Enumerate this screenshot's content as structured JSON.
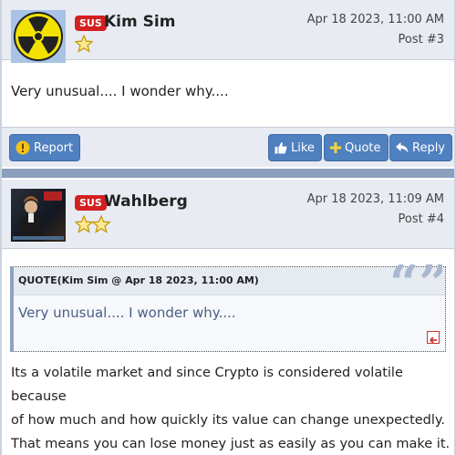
{
  "posts": [
    {
      "badge": "SUS",
      "username": "Kim Sim",
      "date": "Apr 18 2023, 11:00 AM",
      "post_number": "Post #3",
      "avatar_icon": "radiation-icon",
      "stars": 1,
      "body": "Very unusual.... I wonder why...."
    },
    {
      "badge": "SUS",
      "username": "Wahlberg",
      "date": "Apr 18 2023, 11:09 AM",
      "post_number": "Post #4",
      "avatar_icon": "album-cover-image",
      "stars": 2,
      "quote": {
        "header": "QUOTE(Kim Sim @ Apr 18 2023, 11:00 AM)",
        "text": "Very unusual.... I wonder why...."
      },
      "body_lines": [
        "Its a volatile market and since Crypto is considered volatile because",
        "of how much and how quickly its value can change unexpectedly.",
        "That means you can lose money just as easily as you can make it."
      ]
    }
  ],
  "actions": {
    "report": "Report",
    "like": "Like",
    "quote": "Quote",
    "reply": "Reply"
  },
  "colors": {
    "badge": "#d32020",
    "button": "#4f80c0",
    "header_bg": "#e8ecf2",
    "separator": "#8aa0bd"
  }
}
